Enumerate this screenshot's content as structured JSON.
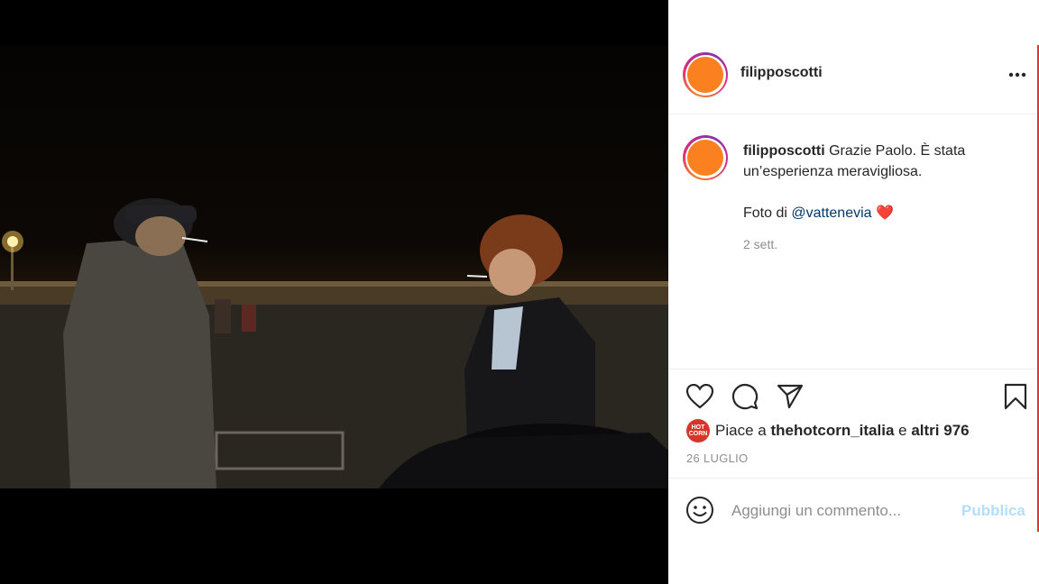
{
  "post": {
    "username": "filipposcotti",
    "caption": {
      "username": "filipposcotti",
      "text": "Grazie Paolo. È stata un’esperienza meravigliosa.",
      "photo_credit_prefix": "Foto di ",
      "mention": "@vattenevia",
      "emoji": "❤️"
    },
    "time_ago": "2 sett.",
    "likes": {
      "prefix": "Piace a ",
      "user": "thehotcorn_italia",
      "middle": " e ",
      "others": "altri 976",
      "badge_text": "HOT CORN"
    },
    "date": "26 LUGLIO",
    "comment": {
      "placeholder": "Aggiungi un commento...",
      "publish_label": "Pubblica"
    },
    "colors": {
      "avatar_fill": "#fb8120",
      "mention": "#00376b",
      "publish_disabled": "#b2dffc",
      "badge": "#d9342b"
    },
    "icons": [
      "more-icon",
      "heart-icon",
      "comment-icon",
      "share-icon",
      "bookmark-icon",
      "emoji-icon"
    ]
  }
}
